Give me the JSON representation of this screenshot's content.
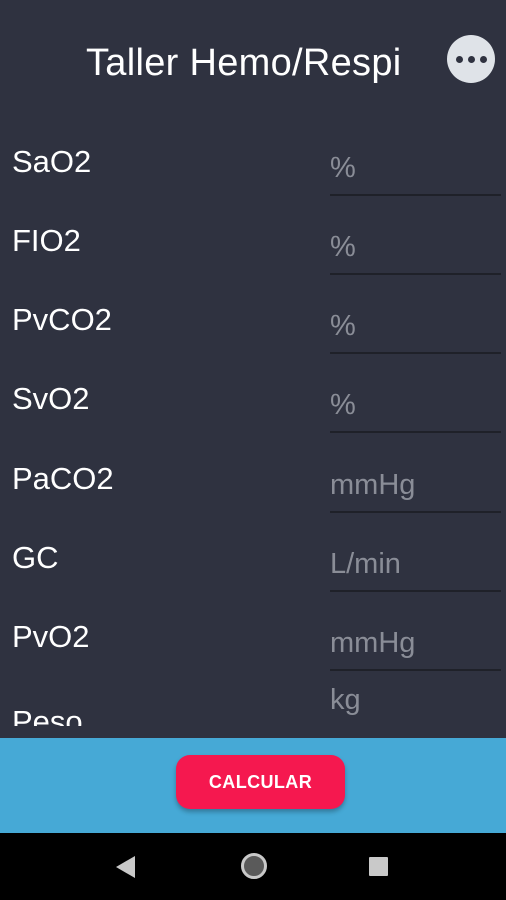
{
  "app": {
    "title": "Taller Hemo/Respi",
    "more_icon": "more-horizontal-icon"
  },
  "fields": [
    {
      "label": "SaO2",
      "placeholder": "%",
      "value": ""
    },
    {
      "label": "FIO2",
      "placeholder": "%",
      "value": ""
    },
    {
      "label": "PvCO2",
      "placeholder": "%",
      "value": ""
    },
    {
      "label": "SvO2",
      "placeholder": "%",
      "value": ""
    },
    {
      "label": "PaCO2",
      "placeholder": "mmHg",
      "value": ""
    },
    {
      "label": "GC",
      "placeholder": "L/min",
      "value": ""
    },
    {
      "label": "PvO2",
      "placeholder": "mmHg",
      "value": ""
    },
    {
      "label": "Peso",
      "placeholder": "kg",
      "value": ""
    }
  ],
  "actions": {
    "calculate_label": "CALCULAR"
  },
  "colors": {
    "background": "#2f3240",
    "bottom_bar": "#46a9d6",
    "accent_button": "#f5184f",
    "placeholder_text": "#8a8d97"
  },
  "system_nav": {
    "back_icon": "back-triangle-icon",
    "home_icon": "home-circle-icon",
    "recents_icon": "recents-square-icon"
  }
}
